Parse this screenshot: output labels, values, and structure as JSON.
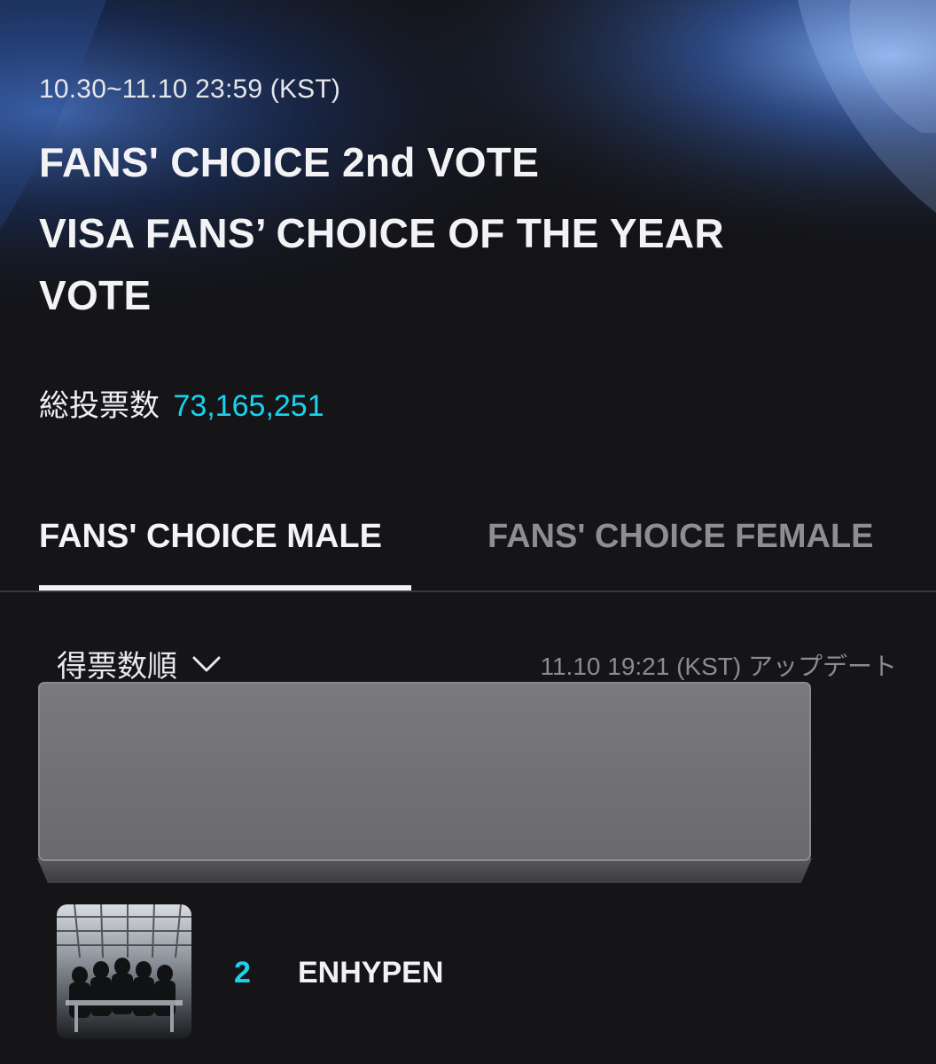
{
  "header": {
    "date_range": "10.30~11.10 23:59 (KST)",
    "title_line1": "FANS' CHOICE 2nd VOTE",
    "title_line2": "VISA FANS’ CHOICE OF THE YEAR",
    "title_line3": "VOTE"
  },
  "totals": {
    "label": "総投票数",
    "value": "73,165,251"
  },
  "tabs": [
    {
      "label": "FANS' CHOICE MALE",
      "active": true
    },
    {
      "label": "FANS' CHOICE FEMALE",
      "active": false
    }
  ],
  "toolbar": {
    "sort_label": "得票数順",
    "sort_icon": "chevron-down-icon",
    "updated_text": "11.10 19:21 (KST) アップデート"
  },
  "ranking": [
    {
      "rank": "2",
      "artist": "ENHYPEN"
    }
  ],
  "colors": {
    "background": "#151518",
    "accent": "#19d3ee",
    "inactive_tab": "#8d8e94",
    "redaction": "#6e6e70"
  }
}
